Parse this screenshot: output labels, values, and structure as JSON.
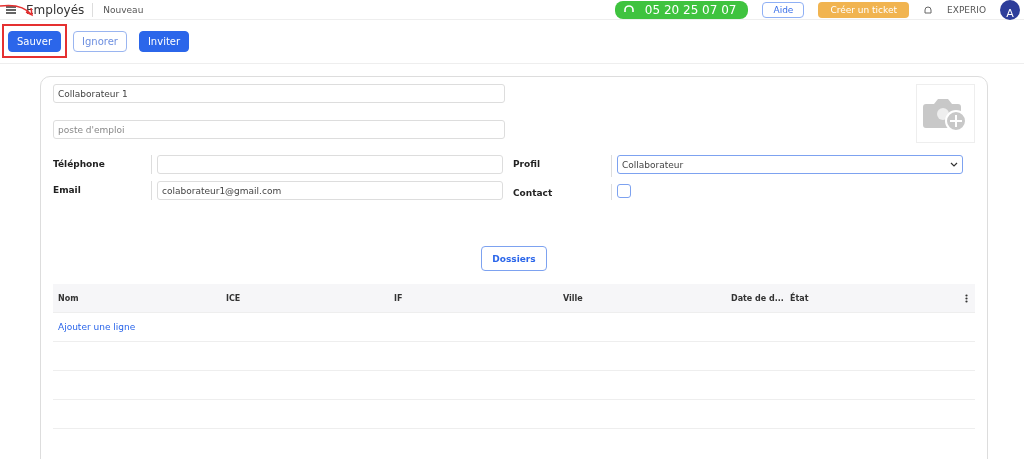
{
  "header": {
    "title": "Employés",
    "breadcrumb": "Nouveau",
    "phone": "05 20 25 07 07",
    "help": "Aide",
    "ticket": "Créer un ticket",
    "company": "EXPERIO",
    "avatar": "A"
  },
  "actions": [
    {
      "label": "Sauver",
      "kind": "primary",
      "highlighted": true
    },
    {
      "label": "Ignorer",
      "kind": "outline",
      "highlighted": false
    },
    {
      "label": "Inviter",
      "kind": "primary",
      "highlighted": false
    }
  ],
  "form": {
    "name": "Collaborateur 1",
    "job_placeholder": "poste d'emploi",
    "left_fields": [
      {
        "label": "Téléphone"
      },
      {
        "label": "Email",
        "value": "colaborateur1@gmail.com"
      }
    ],
    "profile": {
      "label": "Profil",
      "value": "Collaborateur"
    },
    "contact": {
      "label": "Contact",
      "checked": false
    }
  },
  "tab_button": "Dossiers",
  "table": {
    "columns": [
      "Nom",
      "ICE",
      "IF",
      "Ville",
      "Date de d...",
      "État"
    ],
    "add_row": "Ajouter une ligne"
  }
}
